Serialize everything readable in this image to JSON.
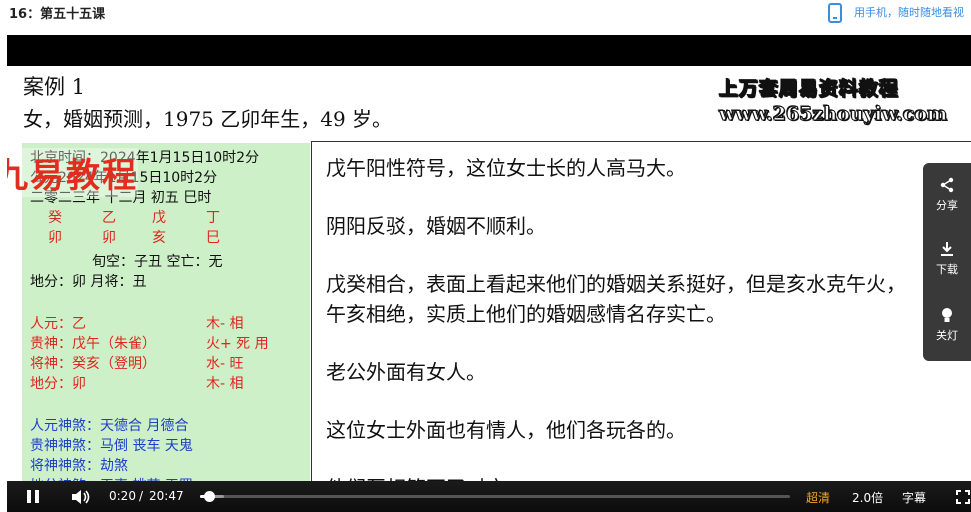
{
  "header": {
    "lesson_title": "16：第五十五课",
    "phone_link": "用手机，随时随地看视"
  },
  "slide": {
    "case_title": "案例 1",
    "case_subtitle": "女，婚姻预测，1975 乙卯年生，49 岁。",
    "watermark_line1": "上万套周易资料教程",
    "watermark_line2": "www.265zhouyiw.com",
    "overlay_logo": "九易教程",
    "chart": {
      "line1": "北京时间：2024年1月15日10时2分",
      "line2": "公元2024年1月15日10时2分",
      "line3": "二零二三年 十二月 初五 巳时",
      "stems": [
        "癸",
        "乙",
        "戊",
        "丁"
      ],
      "branches_partial": [
        "卯",
        "卯",
        "亥",
        "巳"
      ],
      "line_empty": "旬空：子丑  空亡：无",
      "line_difen": "地分：卯      月将：丑",
      "renyuan": "人元：乙",
      "renyuan_status": "木- 相",
      "guishen": "贵神：戊午（朱雀）",
      "guishen_status": "火+ 死 用",
      "jiangshen": "将神：癸亥（登明）",
      "jiangshen_status": "水- 旺",
      "difen": "地分：卯",
      "difen_status": "木- 相",
      "sha1": "人元神煞：天德合 月德合",
      "sha2": "贵神神煞：马倒 丧车 天鬼",
      "sha3": "将神神煞：劫煞",
      "sha4": "地分神煞：天喜 桃花 天罡"
    },
    "text_lines": [
      "戊午阳性符号，这位女士长的人高马大。",
      "阴阳反驳，婚姻不顺利。",
      "戊癸相合，表面上看起来他们的婚姻关系挺好，但是亥水克午火，",
      "午亥相绝，实质上他们的婚姻感情名存实亡。",
      "老公外面有女人。",
      "这位女士外面也有情人，他们各玩各的。",
      "他们互相管不了对方。"
    ]
  },
  "side_panel": {
    "share_label": "分享",
    "download_label": "下载",
    "light_label": "关灯",
    "share_icon": "share-icon",
    "download_icon": "download-icon",
    "light_icon": "lightbulb-icon"
  },
  "player": {
    "current_time": "0:20",
    "separator": "/",
    "duration": "20:47",
    "progress_fraction": 0.016,
    "buffer_fraction": 0.04,
    "quality_label": "超清",
    "speed_label": "2.0倍",
    "subtitle_label": "字幕",
    "colors": {
      "quality": "#f5a623",
      "accent_link": "#3b8de0"
    }
  }
}
